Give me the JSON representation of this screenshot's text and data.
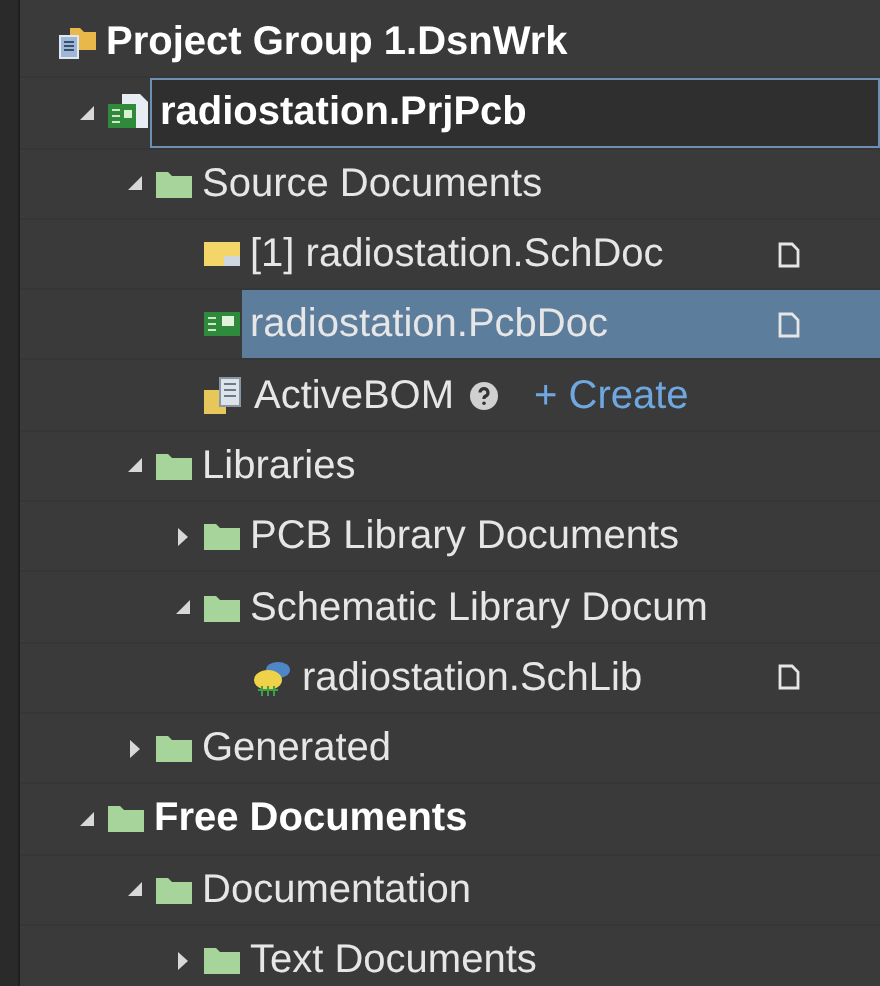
{
  "tree": [
    {
      "label": "Project Group 1.DsnWrk",
      "kind": "group",
      "bold": true,
      "children": [
        {
          "label": "radiostation.PrjPcb",
          "kind": "project",
          "bold": true,
          "focused": true,
          "expanded": true,
          "children": [
            {
              "label": "Source Documents",
              "kind": "folder",
              "expanded": true,
              "children": [
                {
                  "label": "[1] radiostation.SchDoc",
                  "kind": "schdoc",
                  "selected": false,
                  "open_doc": true
                },
                {
                  "label": "radiostation.PcbDoc",
                  "kind": "pcbdoc",
                  "selected": true,
                  "open_doc": true
                },
                {
                  "label": "ActiveBOM",
                  "kind": "bom",
                  "selected": false,
                  "help": true,
                  "link": "+ Create"
                }
              ]
            },
            {
              "label": "Libraries",
              "kind": "folder",
              "expanded": true,
              "children": [
                {
                  "label": "PCB Library Documents",
                  "kind": "folder",
                  "expanded": false
                },
                {
                  "label": "Schematic Library Docum",
                  "kind": "folder",
                  "expanded": true,
                  "children": [
                    {
                      "label": "radiostation.SchLib",
                      "kind": "schlib",
                      "selected": false,
                      "open_doc": true
                    }
                  ]
                }
              ]
            },
            {
              "label": "Generated",
              "kind": "folder",
              "expanded": false
            }
          ]
        },
        {
          "label": "Free Documents",
          "kind": "folder",
          "bold": true,
          "expanded": true,
          "children": [
            {
              "label": "Documentation",
              "kind": "folder",
              "expanded": true,
              "children": [
                {
                  "label": "Text Documents",
                  "kind": "folder",
                  "expanded": false
                }
              ]
            }
          ]
        }
      ]
    }
  ]
}
